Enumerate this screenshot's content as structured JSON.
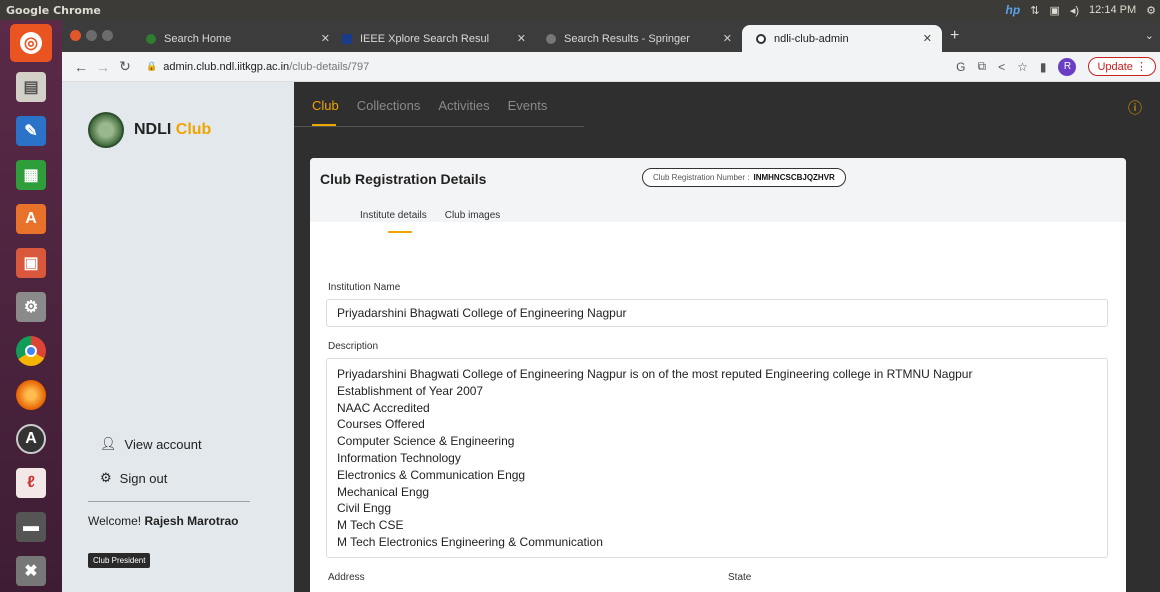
{
  "os": {
    "title": "Google Chrome",
    "time": "12:14 PM",
    "tray": [
      "hp",
      "⇅",
      "▣",
      "◂)"
    ]
  },
  "browser": {
    "tabs": [
      {
        "label": "Search Home",
        "color": "#2e7d32"
      },
      {
        "label": "IEEE Xplore Search Resul",
        "color": "#1a3a8a"
      },
      {
        "label": "Search Results - Springer",
        "color": "#777777"
      },
      {
        "label": "ndli-club-admin",
        "color": "#ffffff"
      }
    ],
    "url_host": "admin.club.ndl.iitkgp.ac.in",
    "url_path": "/club-details/797",
    "avatar_letter": "R",
    "update_label": "Update"
  },
  "sidebar": {
    "logo_main": "NDLI",
    "logo_accent": "Club",
    "view_account": "View account",
    "sign_out": "Sign out",
    "welcome_prefix": "Welcome!",
    "user_name": "Rajesh Marotrao",
    "role": "Club President"
  },
  "nav": {
    "tabs": [
      "Club",
      "Collections",
      "Activities",
      "Events"
    ],
    "active": "Club"
  },
  "card": {
    "title": "Club Registration Details",
    "reg_label": "Club Registration Number :",
    "reg_number": "INMHNCSCBJQZHVR",
    "subtabs": [
      "Institute details",
      "Club images"
    ],
    "institution_label": "Institution Name",
    "institution_value": "Priyadarshini Bhagwati College of Engineering Nagpur",
    "description_label": "Description",
    "description_lines": [
      "Priyadarshini Bhagwati College of Engineering Nagpur is on of the most reputed Engineering college in RTMNU Nagpur",
      "Establishment of Year 2007",
      "NAAC Accredited",
      "Courses Offered",
      "Computer Science & Engineering",
      "Information Technology",
      "Electronics & Communication Engg",
      "Mechanical Engg",
      "Civil Engg",
      "M Tech CSE",
      "M Tech Electronics Engineering & Communication"
    ],
    "address_label": "Address",
    "state_label": "State"
  },
  "colors": {
    "accent": "#f0a400",
    "launcher": "#5a2a48"
  }
}
